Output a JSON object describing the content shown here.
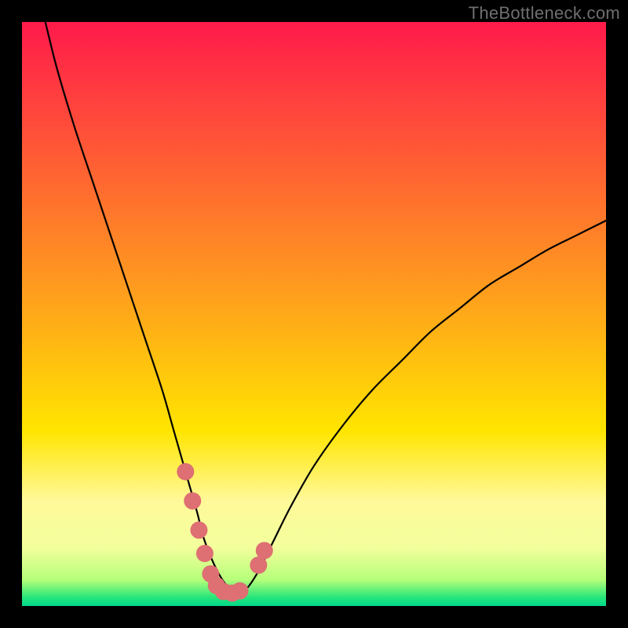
{
  "watermark": "TheBottleneck.com",
  "chart_data": {
    "type": "line",
    "title": "",
    "xlabel": "",
    "ylabel": "",
    "xlim": [
      0,
      100
    ],
    "ylim": [
      0,
      100
    ],
    "grid": false,
    "legend": false,
    "background_gradient": {
      "stops": [
        {
          "pos": 0.0,
          "color": "#ff1a4b"
        },
        {
          "pos": 0.45,
          "color": "#ff9a1f"
        },
        {
          "pos": 0.7,
          "color": "#ffe500"
        },
        {
          "pos": 0.82,
          "color": "#fff99a"
        },
        {
          "pos": 0.9,
          "color": "#f3ff9c"
        },
        {
          "pos": 0.955,
          "color": "#b6ff7a"
        },
        {
          "pos": 0.985,
          "color": "#28e67a"
        },
        {
          "pos": 1.0,
          "color": "#00d98c"
        }
      ]
    },
    "series": [
      {
        "name": "bottleneck-curve",
        "x": [
          4,
          6,
          9,
          12,
          15,
          18,
          21,
          24,
          26,
          28,
          30,
          31,
          32.5,
          34,
          35.5,
          37,
          38.5,
          40.5,
          43,
          46,
          50,
          55,
          60,
          65,
          70,
          75,
          80,
          85,
          90,
          95,
          100
        ],
        "y": [
          100,
          92,
          82,
          73,
          64,
          55,
          46,
          37,
          30,
          23,
          16,
          12,
          8,
          5,
          3,
          2,
          3,
          6,
          11,
          17,
          24,
          31,
          37,
          42,
          47,
          51,
          55,
          58,
          61,
          63.5,
          66
        ]
      }
    ],
    "highlight_points": {
      "name": "pink-markers",
      "color": "#de6f73",
      "points": [
        {
          "x": 28.0,
          "y": 23.0
        },
        {
          "x": 29.2,
          "y": 18.0
        },
        {
          "x": 30.3,
          "y": 13.0
        },
        {
          "x": 31.3,
          "y": 9.0
        },
        {
          "x": 32.3,
          "y": 5.5
        },
        {
          "x": 33.3,
          "y": 3.5
        },
        {
          "x": 34.5,
          "y": 2.5
        },
        {
          "x": 36.0,
          "y": 2.2
        },
        {
          "x": 37.3,
          "y": 2.6
        },
        {
          "x": 40.5,
          "y": 7.0
        },
        {
          "x": 41.5,
          "y": 9.5
        }
      ]
    }
  }
}
